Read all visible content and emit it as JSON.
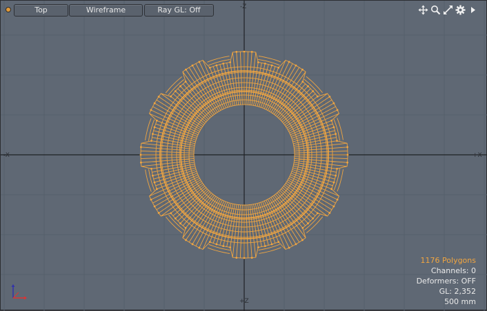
{
  "toolbar": {
    "view_label": "Top",
    "shading_label": "Wireframe",
    "raygl_label": "Ray GL: Off",
    "icons": [
      "move-view-icon",
      "zoom-icon",
      "maximize-icon",
      "settings-icon",
      "play-arrow-icon"
    ]
  },
  "axes": {
    "top_label": "-Z",
    "bottom_label": "+Z",
    "left_label": "-X",
    "right_label": "+X"
  },
  "stats": {
    "polygons": "1176 Polygons",
    "channels": "Channels: 0",
    "deformers": "Deformers: OFF",
    "gl": "GL: 2,352",
    "scale": "500 mm"
  },
  "colors": {
    "viewport_bg": "#5f6874",
    "mesh": "#f2a640",
    "grid": "#56606b",
    "axis": "#1f2124",
    "text": "#eaeaea"
  }
}
